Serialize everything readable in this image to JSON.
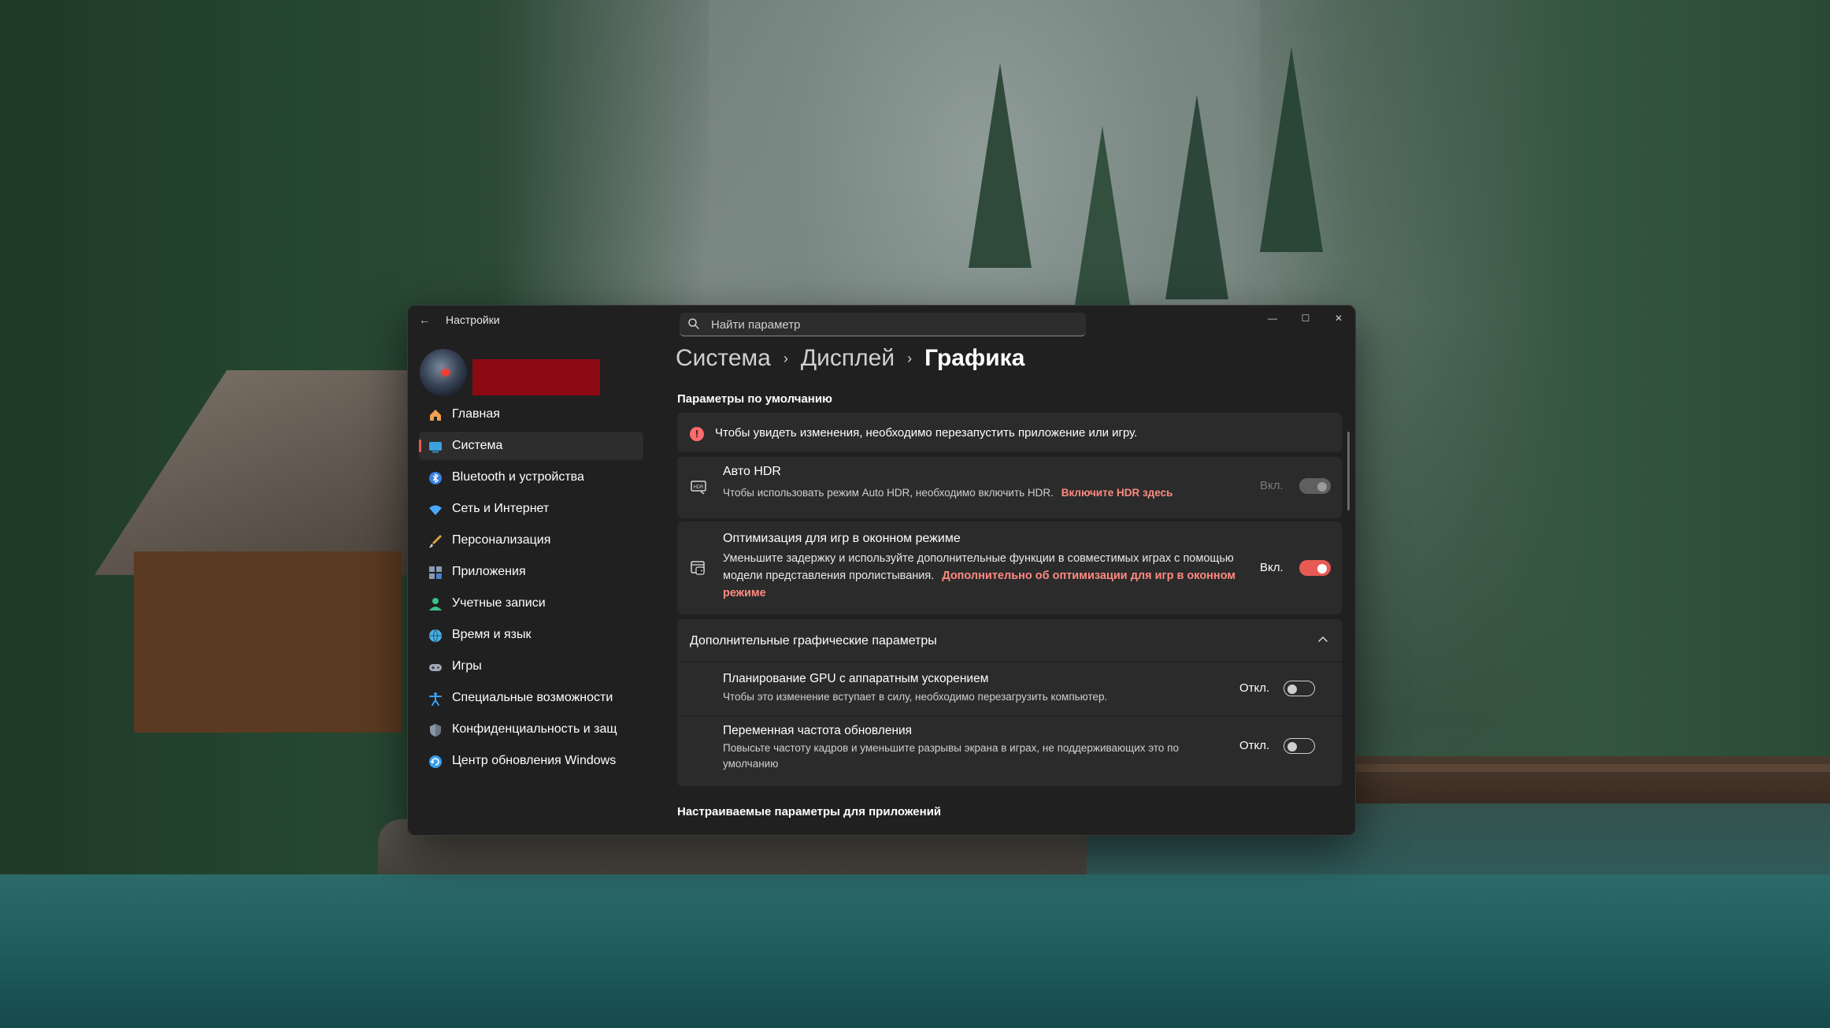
{
  "window": {
    "app_title": "Настройки",
    "back_glyph": "←",
    "min_glyph": "—",
    "max_glyph": "☐",
    "close_glyph": "✕"
  },
  "search": {
    "placeholder": "Найти параметр",
    "value": ""
  },
  "sidebar": {
    "items": [
      {
        "label": "Главная",
        "icon": "home-icon",
        "color": "#f0a050"
      },
      {
        "label": "Система",
        "icon": "system-icon",
        "color": "#3aa0e0",
        "active": true
      },
      {
        "label": "Bluetooth и устройства",
        "icon": "bluetooth-icon",
        "color": "#3a7fe0"
      },
      {
        "label": "Сеть и Интернет",
        "icon": "wifi-icon",
        "color": "#4aa8ff"
      },
      {
        "label": "Персонализация",
        "icon": "brush-icon",
        "color": "#e0a040"
      },
      {
        "label": "Приложения",
        "icon": "apps-icon",
        "color": "#8a9ab0"
      },
      {
        "label": "Учетные записи",
        "icon": "account-icon",
        "color": "#3ac08a"
      },
      {
        "label": "Время и язык",
        "icon": "globe-icon",
        "color": "#4ab0e0"
      },
      {
        "label": "Игры",
        "icon": "gamepad-icon",
        "color": "#a0a8b8"
      },
      {
        "label": "Специальные возможности",
        "icon": "accessibility-icon",
        "color": "#3aa0f0"
      },
      {
        "label": "Конфиденциальность и защ",
        "icon": "shield-icon",
        "color": "#8a96a8"
      },
      {
        "label": "Центр обновления Windows",
        "icon": "update-icon",
        "color": "#3aa0f0"
      }
    ]
  },
  "breadcrumb": {
    "item1": "Система",
    "item2": "Дисплей",
    "current": "Графика",
    "sep": "›"
  },
  "defaults": {
    "section_title": "Параметры по умолчанию",
    "info_glyph": "!",
    "info_text": "Чтобы увидеть изменения, необходимо перезапустить приложение или игру.",
    "auto_hdr": {
      "title": "Авто HDR",
      "desc": "Чтобы использовать режим Auto HDR, необходимо включить HDR.",
      "link": "Включите HDR здесь",
      "state_label": "Вкл."
    },
    "windowed_opt": {
      "title": "Оптимизация для игр в оконном режиме",
      "desc": "Уменьшите задержку и используйте дополнительные функции в совместимых играх с помощью модели представления пролистывания.",
      "link": "Дополнительно об оптимизации для игр в оконном режиме",
      "state_label": "Вкл."
    }
  },
  "advanced": {
    "title": "Дополнительные графические параметры",
    "gpu_scheduling": {
      "title": "Планирование GPU с аппаратным ускорением",
      "desc": "Чтобы это изменение вступает в силу, необходимо перезагрузить компьютер.",
      "state_label": "Откл."
    },
    "vrr": {
      "title": "Переменная частота обновления",
      "desc": "Повысьте частоту кадров и уменьшите разрывы экрана в играх, не поддерживающих это по умолчанию",
      "state_label": "Откл."
    }
  },
  "custom": {
    "section_title": "Настраиваемые параметры для приложений"
  },
  "colors": {
    "accent": "#e85b52",
    "link": "#ff8a80",
    "window_bg": "#202020",
    "card_bg": "#2b2b2b"
  }
}
